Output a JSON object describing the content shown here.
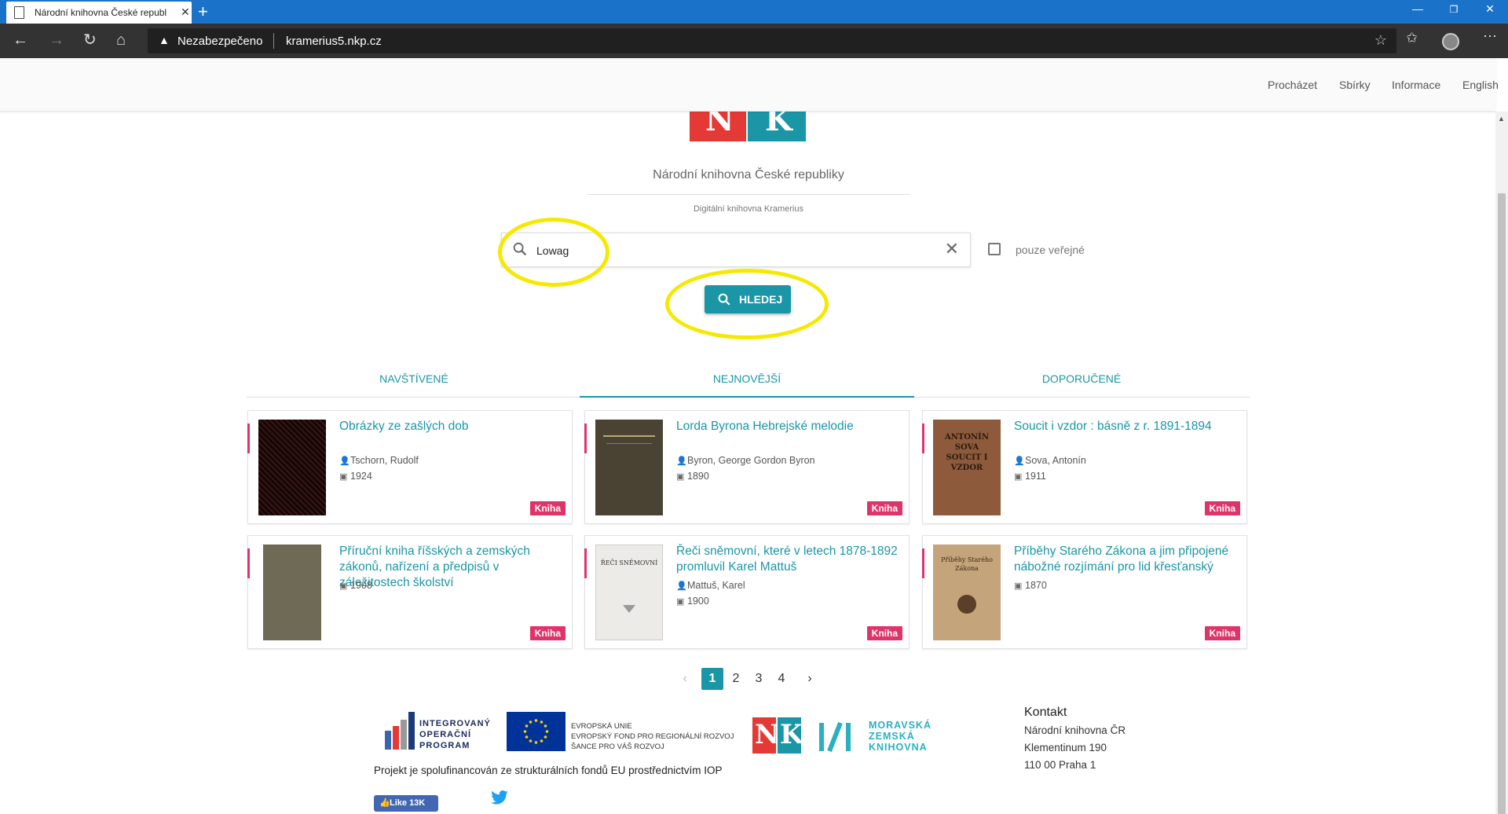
{
  "browser": {
    "tab_title": "Národní knihovna České republ",
    "new_tab": "+",
    "security_label": "Nezabezpečeno",
    "url": "kramerius5.nkp.cz"
  },
  "header": {
    "nav": [
      "Procházet",
      "Sbírky",
      "Informace",
      "English"
    ]
  },
  "logo": {
    "left_letter": "N",
    "right_letter": "K"
  },
  "library": {
    "name": "Národní knihovna České republiky",
    "subtitle": "Digitální knihovna Kramerius"
  },
  "search": {
    "value": "Lowag",
    "public_only_label": "pouze veřejné",
    "button_label": "HLEDEJ"
  },
  "tabs": [
    "NAVŠTÍVENÉ",
    "NEJNOVĚJŠÍ",
    "DOPORUČENÉ"
  ],
  "active_tab": "NEJNOVĚJŠÍ",
  "cards": [
    {
      "title": "Obrázky ze zašlých dob",
      "author": "Tschorn, Rudolf",
      "year": "1924",
      "badge": "Kniha"
    },
    {
      "title": "Lorda Byrona Hebrejské melodie",
      "author": "Byron, George Gordon Byron",
      "year": "1890",
      "badge": "Kniha"
    },
    {
      "title": "Soucit i vzdor : básně z r. 1891-1894",
      "author": "Sova, Antonín",
      "year": "1911",
      "badge": "Kniha",
      "cover_text": "ANTONÍN SOVA SOUCIT I VZDOR"
    },
    {
      "title": "Příruční kniha říšských a zemských zákonů, nařízení a předpisů v záležitostech školství",
      "author": "",
      "year": "1908",
      "badge": "Kniha"
    },
    {
      "title": "Řeči sněmovní, které v letech 1878-1892 promluvil Karel Mattuš",
      "author": "Mattuš, Karel",
      "year": "1900",
      "badge": "Kniha",
      "cover_text": "ŘEČI SNĚMOVNÍ"
    },
    {
      "title": "Příběhy Starého Zákona a jim připojené nábožné rozjímání pro lid křesťanský",
      "author": "",
      "year": "1870",
      "badge": "Kniha",
      "cover_text": "Příběhy Starého Zákona"
    }
  ],
  "pagination": {
    "pages": [
      "1",
      "2",
      "3",
      "4"
    ],
    "current": "1",
    "prev": "‹",
    "next": "›"
  },
  "footer": {
    "iop": [
      "INTEGROVANÝ",
      "OPERAČNÍ",
      "PROGRAM"
    ],
    "eu": [
      "EVROPSKÁ UNIE",
      "EVROPSKÝ FOND PRO REGIONÁLNÍ ROZVOJ",
      "ŠANCE PRO VÁŠ ROZVOJ"
    ],
    "mzk": [
      "MORAVSKÁ",
      "ZEMSKÁ",
      "KNIHOVNA"
    ],
    "project_text": "Projekt je spolufinancován ze strukturálních fondů EU prostřednictvím IOP",
    "fb_like": "Like 13K",
    "contact": {
      "title": "Kontakt",
      "lines": [
        "Národní knihovna ČR",
        "Klementinum 190",
        "110 00 Praha 1"
      ]
    }
  },
  "colors": {
    "accent": "#1a96a6",
    "badge": "#e0336a",
    "highlight": "#f5e900",
    "logo_red": "#e53935"
  }
}
